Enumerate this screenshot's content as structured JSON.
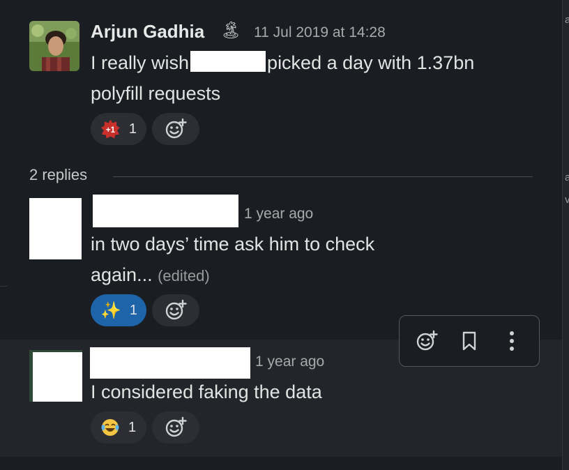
{
  "right_edge_chars": [
    "a",
    "a",
    "v"
  ],
  "thread": {
    "parent": {
      "author": "Arjun Gadhia",
      "status_emoji": "🏝",
      "timestamp": "11 Jul 2019 at 14:28",
      "text_line1_start": "I really wish",
      "text_line1_end": "picked a day with 1.37bn",
      "text_line2": "polyfill requests",
      "reaction": {
        "emoji": "+1",
        "count": "1"
      }
    },
    "replies_label": "2 replies",
    "reply1": {
      "timestamp": "1 year ago",
      "text_line1": "in two days’ time ask him to check",
      "text_line2": "again...",
      "edited": "(edited)",
      "reaction": {
        "emoji": "✨",
        "count": "1"
      }
    },
    "reply2": {
      "timestamp": "1 year ago",
      "text": "I considered faking the data",
      "reaction": {
        "emoji": "😂",
        "count": "1"
      }
    }
  },
  "colors": {
    "background": "#1a1d21",
    "active_reaction": "#1d64a8",
    "reaction_bg": "#2c2e33"
  },
  "icons": {
    "add_reaction": "emoji-add-icon",
    "bookmark": "bookmark-icon",
    "more": "more-vertical-icon"
  }
}
